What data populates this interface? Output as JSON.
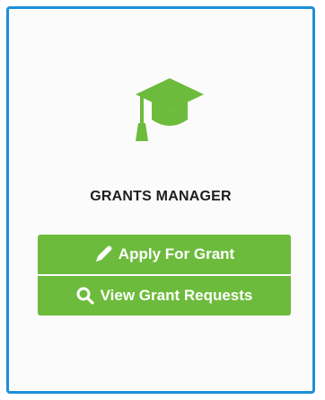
{
  "widget": {
    "title": "GRANTS MANAGER",
    "icon": "graduation-cap-icon",
    "border_color": "#1d8fd6",
    "accent_color": "#6dbb3c"
  },
  "actions": {
    "apply": {
      "label": "Apply For Grant",
      "icon": "pencil-icon"
    },
    "view": {
      "label": "View Grant Requests",
      "icon": "search-icon"
    }
  }
}
